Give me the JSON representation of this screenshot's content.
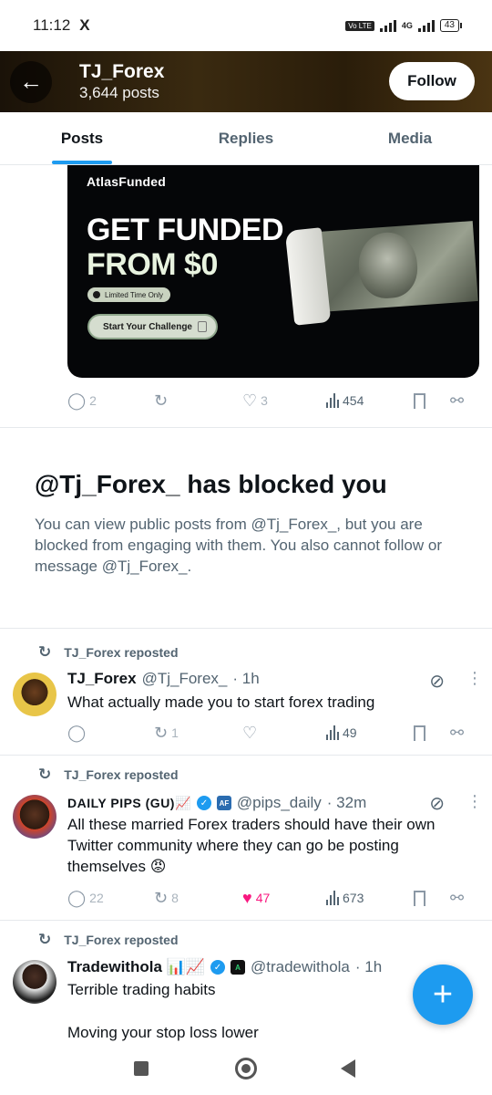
{
  "status_bar": {
    "time": "11:12",
    "app_icon": "X",
    "net": "4G",
    "volte": "Vo LTE",
    "battery": "43"
  },
  "header": {
    "name": "TJ_Forex",
    "posts_count": "3,644 posts",
    "follow_label": "Follow",
    "back_icon": "arrow-left-icon"
  },
  "tabs": [
    {
      "label": "Posts",
      "active": true
    },
    {
      "label": "Replies",
      "active": false
    },
    {
      "label": "Media",
      "active": false
    }
  ],
  "ad": {
    "brand": "AtlasFunded",
    "headline_1": "GET FUNDED",
    "headline_2": "FROM $0",
    "limited": "Limited Time Only",
    "cta": "Start Your Challenge",
    "stats": {
      "replies": "2",
      "reposts": "",
      "likes": "3",
      "views": "454"
    }
  },
  "blocked": {
    "title": "@Tj_Forex_ has blocked you",
    "text": "You can view public posts from @Tj_Forex_, but you are blocked from engaging with them. You also cannot follow or message @Tj_Forex_."
  },
  "posts": [
    {
      "repost_label": "TJ_Forex reposted",
      "name": "TJ_Forex",
      "handle": "@Tj_Forex_",
      "time": "· 1h",
      "body": "What actually made you to start forex trading",
      "stats": {
        "replies": "",
        "reposts": "1",
        "likes": "",
        "views": "49"
      }
    },
    {
      "repost_label": "TJ_Forex reposted",
      "name": "DAILY PIPS (GU)📈",
      "handle": "@pips_daily",
      "time": "· 32m",
      "badge": "AF",
      "body": "All these married Forex traders should have their own Twitter community where they can go be posting themselves 😡",
      "stats": {
        "replies": "22",
        "reposts": "8",
        "likes": "47",
        "views": "673"
      }
    },
    {
      "repost_label": "TJ_Forex reposted",
      "name": "Tradewithola 📊📈",
      "handle": "@tradewithola",
      "time": "· 1h",
      "badge": "A",
      "body_line_1": "Terrible trading habits",
      "body_line_2": "Moving your stop loss lower"
    }
  ],
  "fab": {
    "label": "+"
  },
  "colors": {
    "accent": "#1d9bf0",
    "like": "#f91880",
    "text": "#0f1419",
    "muted": "#536471"
  }
}
